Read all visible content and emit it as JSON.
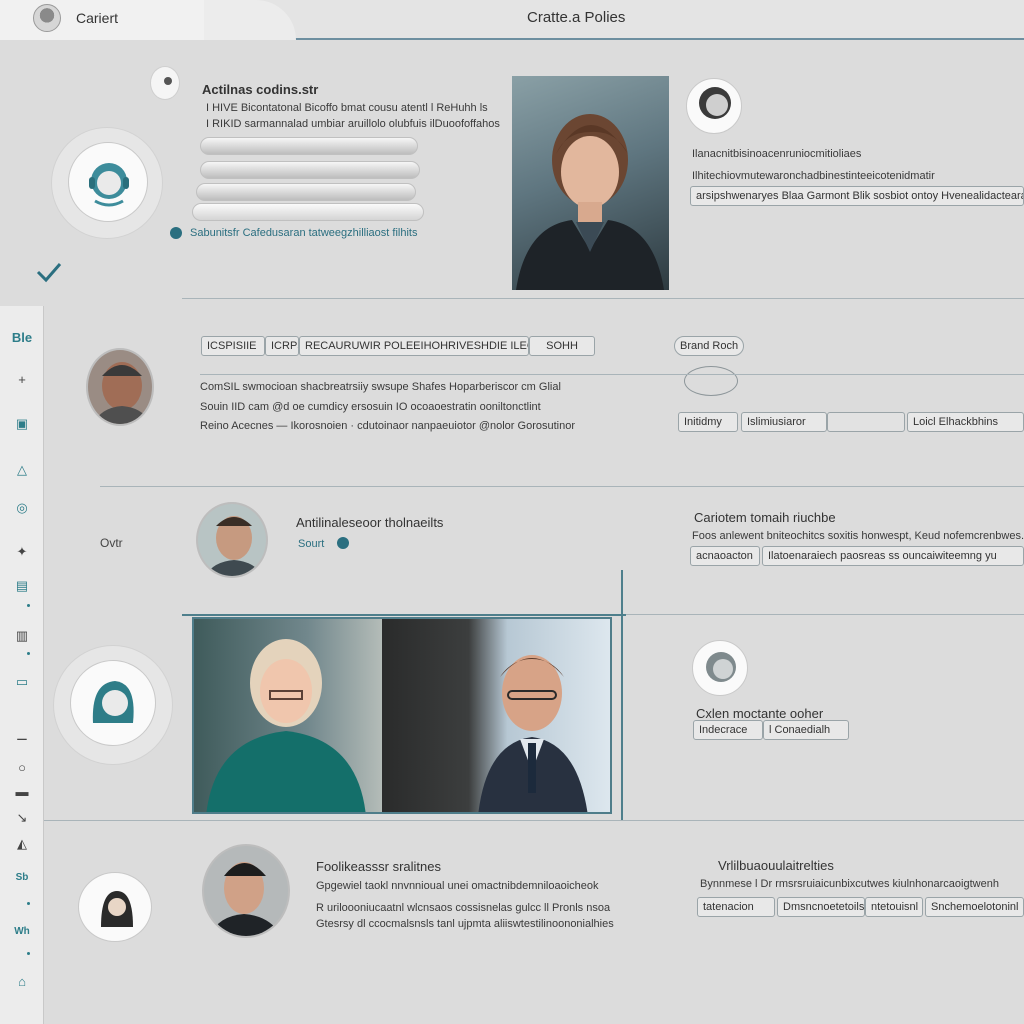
{
  "window": {
    "app_name": "Cariert",
    "title": "Cratte.a Polies"
  },
  "sidebar": {
    "rail_top_label": "Ble",
    "icons": [
      "plus-icon",
      "image-icon",
      "filter-icon",
      "clock-icon",
      "compass-icon",
      "folder-icon",
      "document-icon",
      "chart-icon",
      "settings-icon",
      "circle-icon",
      "list-icon",
      "link-icon",
      "layers-icon",
      "label-icon",
      "user-icon",
      "home-icon"
    ]
  },
  "card1": {
    "heading": "Actilnas codins.str",
    "line1": "I HIVE Bicontatonal Bicoffo bmat cousu atentl l ReHuhh ls",
    "line2": "I RIKID sarmannalad umbiar aruillolo olubfuis ilDuoofoffahos",
    "status_text": "Sabunitsfr Cafedusaran tatweegzhilliaost filhits",
    "right_heading": "Ilanacnitbisinoacenruniocmitioliaes",
    "right_line": "Ilhitechiovmutewaronchadbinestinteeicotenidmatir",
    "chip": "arsipshwenaryes Blaa Garmont Blik sosbiot ontoy Hvenealidactearaceiiegbs"
  },
  "card2": {
    "chips_top": [
      "ICSPISIIE",
      "ICRPSINE",
      "RECAURUWIR POLEEIHOHRIVESHDIE ILEGIS ICHVES RDY",
      "SOHH"
    ],
    "side_label": "Brand Roch",
    "line1": "ComSIL swmocioan shacbreatrsiiy swsupe Shafes Hoparberiscor cm Glial",
    "line2": "Souin IID cam @d oe cumdicy ersosuin IO ocoaoestratin ooniltonctlint",
    "line3": "Reino Acecnes — Ikorosnoien · cdutoinaor nanpaeuiotor @nolor Gorosutinor",
    "chips_right": [
      "Initidmy",
      "Islimiusiaror",
      "Loicl Elhackbhins"
    ]
  },
  "card3": {
    "heading": "Antilinaleseoor tholnaeilts",
    "tag": "Sourt",
    "right_heading": "Cariotem tomaih riuchbe",
    "right_line": "Foos anlewent bniteochitcs soxitis honwespt, Keud nofemcrenbwes.g",
    "chips": [
      "acnaoacton",
      "Ilatoenaraiech paosreas ss ouncaiwiteemng yu"
    ],
    "pin": "Ovtr"
  },
  "card4": {
    "name": "Cxlen moctante ooher",
    "chips": [
      "Indecrace",
      "l Conaedialh"
    ]
  },
  "card5": {
    "heading": "Foolikeasssr sralitnes",
    "line1": "Gpgewiel taokl nnvnnioual unei omactnibdemniloaoicheok",
    "line2": "R uriloooniucaatnl wlcnsaos cossisnelas gulcc ll Pronls nsoa",
    "line3": "Gtesrsy dl ccocmalsnsls tanl ujpmta aliiswtestilinoononialhies",
    "right_heading": "Vrlilbuaouulaitrelties",
    "right_line": "Bynnmese l Dr rmsrsruiaicunbixcutwes kiulnhonarcaoigtwenh",
    "chips": [
      "tatenacion",
      "Dmsncnoetetoils",
      "ntetouisnl",
      "Snchemoelotoninl"
    ]
  }
}
